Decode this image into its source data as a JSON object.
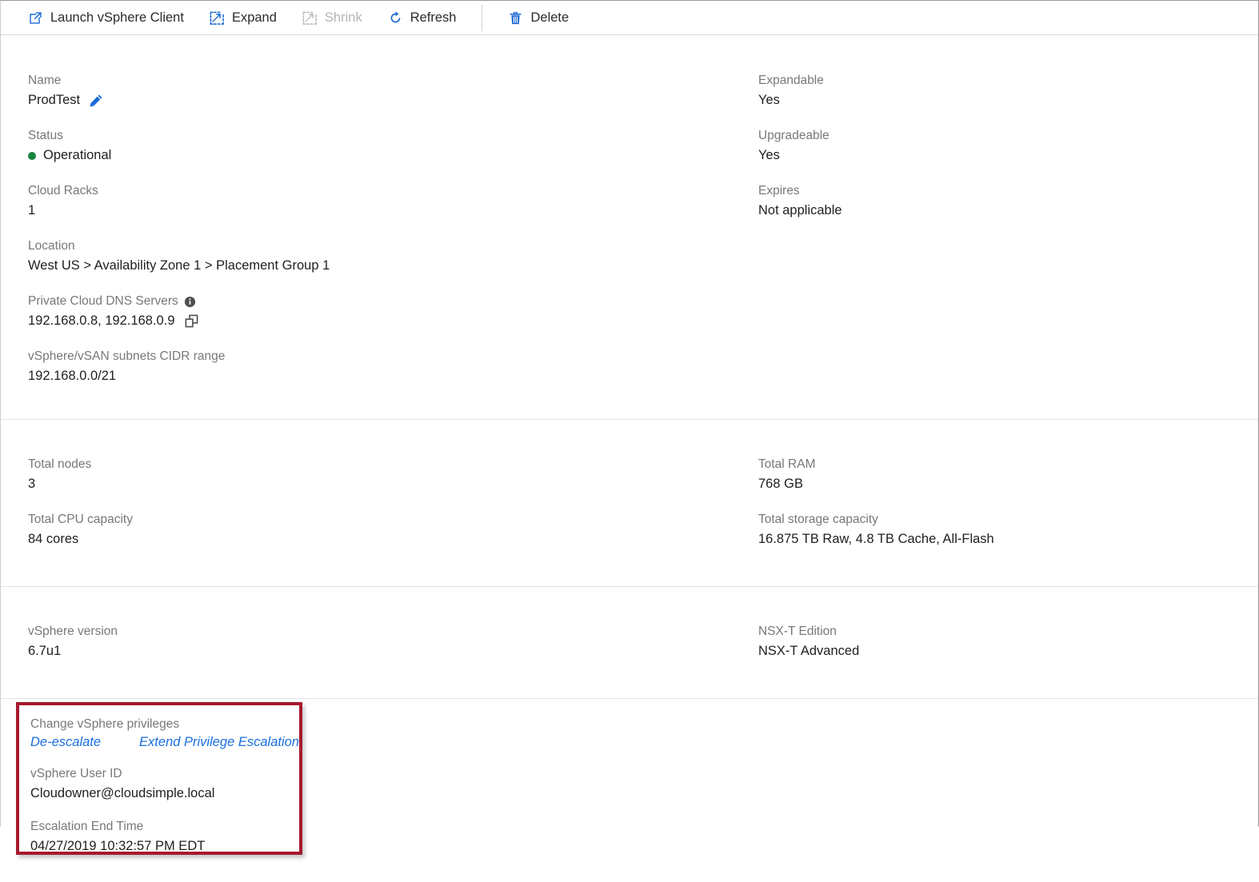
{
  "toolbar": {
    "items": [
      {
        "label": "Launch vSphere Client",
        "icon": "external-link-icon",
        "disabled": false
      },
      {
        "label": "Expand",
        "icon": "expand-icon",
        "disabled": false
      },
      {
        "label": "Shrink",
        "icon": "shrink-icon",
        "disabled": true
      },
      {
        "label": "Refresh",
        "icon": "refresh-icon",
        "disabled": false
      },
      {
        "label": "Delete",
        "icon": "trash-icon",
        "disabled": false
      }
    ]
  },
  "overview": {
    "name_label": "Name",
    "name_value": "ProdTest",
    "status_label": "Status",
    "status_value": "Operational",
    "status_color": "#17843f",
    "cloud_racks_label": "Cloud Racks",
    "cloud_racks_value": "1",
    "location_label": "Location",
    "location_value": "West US > Availability Zone 1 > Placement Group 1",
    "dns_label": "Private Cloud DNS Servers",
    "dns_value": "192.168.0.8, 192.168.0.9",
    "cidr_label": "vSphere/vSAN subnets CIDR range",
    "cidr_value": "192.168.0.0/21",
    "expandable_label": "Expandable",
    "expandable_value": "Yes",
    "upgradeable_label": "Upgradeable",
    "upgradeable_value": "Yes",
    "expires_label": "Expires",
    "expires_value": "Not applicable"
  },
  "capacity": {
    "total_nodes_label": "Total nodes",
    "total_nodes_value": "3",
    "total_cpu_label": "Total CPU capacity",
    "total_cpu_value": "84 cores",
    "total_ram_label": "Total RAM",
    "total_ram_value": "768 GB",
    "total_storage_label": "Total storage capacity",
    "total_storage_value": "16.875 TB Raw, 4.8 TB Cache, All-Flash"
  },
  "software": {
    "vsphere_version_label": "vSphere version",
    "vsphere_version_value": "6.7u1",
    "nsxt_edition_label": "NSX-T Edition",
    "nsxt_edition_value": "NSX-T Advanced"
  },
  "privileges": {
    "change_label": "Change vSphere privileges",
    "deescalate_link": "De-escalate",
    "extend_link": "Extend Privilege Escalation",
    "user_id_label": "vSphere User ID",
    "user_id_value": "Cloudowner@cloudsimple.local",
    "end_time_label": "Escalation End Time",
    "end_time_value": "04/27/2019 10:32:57 PM EDT",
    "highlight_color": "#a6192e",
    "link_color": "#1a6fe0"
  }
}
